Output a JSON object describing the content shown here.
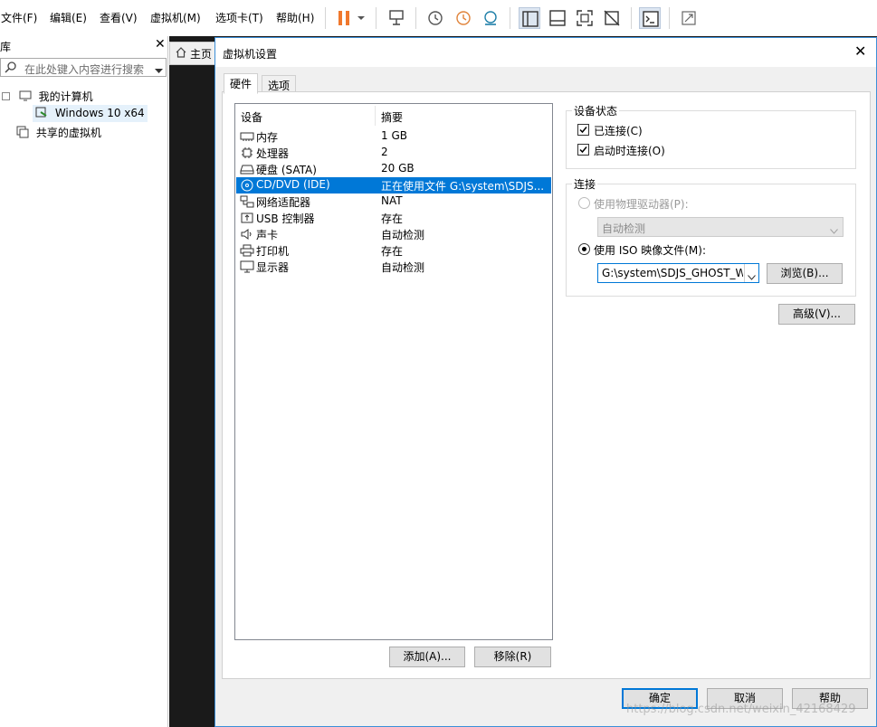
{
  "menu": {
    "file": "文件(F)",
    "edit": "编辑(E)",
    "view": "查看(V)",
    "vm": "虚拟机(M)",
    "tabs": "选项卡(T)",
    "help": "帮助(H)"
  },
  "library": {
    "title_fragment": "库",
    "search_placeholder": "在此处键入内容进行搜索",
    "my_computer": "我的计算机",
    "vm_name": "Windows 10 x64",
    "shared": "共享的虚拟机",
    "home_tab": "主页"
  },
  "dialog": {
    "title": "虚拟机设置",
    "tab_hardware": "硬件",
    "tab_options": "选项",
    "col_device": "设备",
    "col_summary": "摘要",
    "devices": [
      {
        "name": "内存",
        "summary": "1 GB",
        "icon": "memory-icon"
      },
      {
        "name": "处理器",
        "summary": "2",
        "icon": "cpu-icon"
      },
      {
        "name": "硬盘 (SATA)",
        "summary": "20 GB",
        "icon": "hard-disk-icon"
      },
      {
        "name": "CD/DVD (IDE)",
        "summary": "正在使用文件 G:\\system\\SDJS...",
        "icon": "cd-dvd-icon"
      },
      {
        "name": "网络适配器",
        "summary": "NAT",
        "icon": "network-adapter-icon"
      },
      {
        "name": "USB 控制器",
        "summary": "存在",
        "icon": "usb-icon"
      },
      {
        "name": "声卡",
        "summary": "自动检测",
        "icon": "sound-icon"
      },
      {
        "name": "打印机",
        "summary": "存在",
        "icon": "printer-icon"
      },
      {
        "name": "显示器",
        "summary": "自动检测",
        "icon": "display-icon"
      }
    ],
    "add_button": "添加(A)...",
    "remove_button": "移除(R)",
    "device_status": {
      "title": "设备状态",
      "connected": "已连接(C)",
      "connect_at_power_on": "启动时连接(O)"
    },
    "connection": {
      "title": "连接",
      "use_physical": "使用物理驱动器(P):",
      "physical_value": "自动检测",
      "use_iso": "使用 ISO 映像文件(M):",
      "iso_value": "G:\\system\\SDJS_GHOST_W",
      "browse": "浏览(B)...",
      "advanced": "高级(V)..."
    },
    "ok": "确定",
    "cancel": "取消",
    "help": "帮助"
  },
  "watermark": "https://blog.csdn.net/weixin_42168429",
  "colors": {
    "selection": "#0078d7",
    "dialog_border": "#3c8fd8",
    "pause_orange": "#f0782d"
  }
}
